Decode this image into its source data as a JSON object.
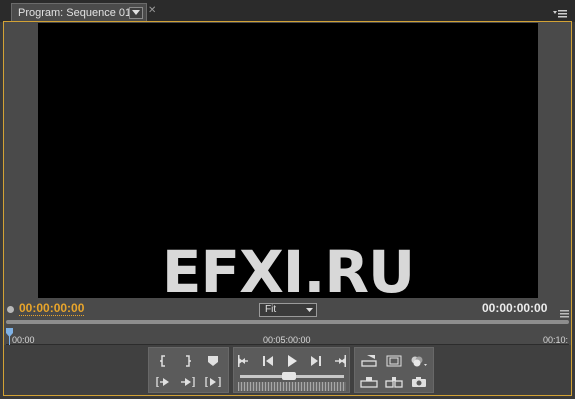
{
  "tab": {
    "title": "Program: Sequence 01"
  },
  "viewer": {
    "watermark": "EFXI.RU"
  },
  "timecode": {
    "current": "00:00:00:00",
    "duration": "00:00:00:00"
  },
  "zoom": {
    "selected": "Fit"
  },
  "ruler": {
    "ticks": [
      "00:00",
      "00:05:00:00",
      "00:10:"
    ]
  },
  "colors": {
    "accent": "#d2a235",
    "timecode_current": "#e8a52b",
    "viewer_bg": "#000000"
  },
  "controls": {
    "group1": [
      "mark-in-icon",
      "mark-out-icon",
      "set-marker-icon",
      "go-to-in-icon",
      "go-to-out-icon",
      "play-in-to-out-icon"
    ],
    "group2": [
      "go-to-previous-edit-icon",
      "step-back-icon",
      "play-icon",
      "step-forward-icon",
      "go-to-next-edit-icon",
      "jog-slider",
      "shuttle"
    ],
    "group3": [
      "lift-icon",
      "extract-icon",
      "safe-margins-icon",
      "output-icon",
      "trim-monitor-icon",
      "export-frame-icon"
    ]
  }
}
